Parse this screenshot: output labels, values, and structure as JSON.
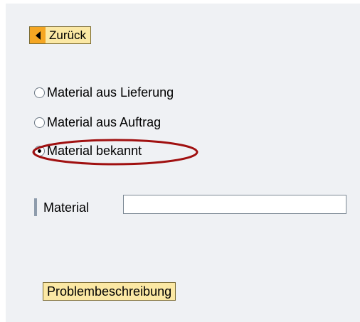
{
  "navigation": {
    "back_label": "Zurück"
  },
  "options": [
    {
      "label": "Material aus Lieferung",
      "selected": false
    },
    {
      "label": "Material aus Auftrag",
      "selected": false
    },
    {
      "label": "Material bekannt",
      "selected": true
    }
  ],
  "material_field": {
    "label": "Material",
    "value": ""
  },
  "actions": {
    "problem_label": "Problembeschreibung"
  },
  "colors": {
    "panel_background": "#eff1f4",
    "button_background": "#fbe8a4",
    "back_arrow_background": "#f5a623",
    "highlight_annotation": "#a01010",
    "field_marker": "#8e9cac"
  }
}
